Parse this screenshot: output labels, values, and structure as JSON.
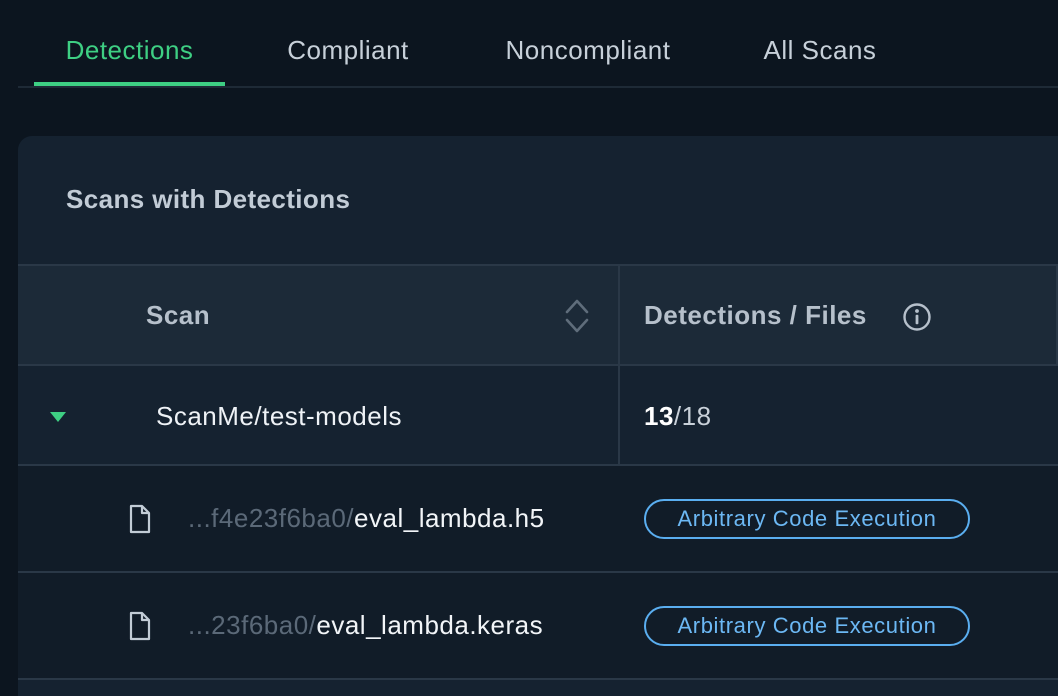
{
  "tabs": [
    {
      "label": "Detections",
      "active": true
    },
    {
      "label": "Compliant",
      "active": false
    },
    {
      "label": "Noncompliant",
      "active": false
    },
    {
      "label": "All Scans",
      "active": false
    }
  ],
  "card": {
    "title": "Scans with Detections"
  },
  "table": {
    "columns": [
      "Scan",
      "Detections / Files"
    ],
    "group": {
      "name": "ScanMe/test-models",
      "detections": "13",
      "separator": "/",
      "files": "18",
      "expanded": true
    },
    "rows": [
      {
        "prefix": "...f4e23f6ba0/",
        "filename": "eval_lambda.h5",
        "badge": "Arbitrary Code Execution"
      },
      {
        "prefix": "...23f6ba0/",
        "filename": "eval_lambda.keras",
        "badge": "Arbitrary Code Execution"
      }
    ]
  },
  "colors": {
    "accent": "#3ecf83",
    "badge": "#5aaef0",
    "background": "#0c151f",
    "card": "#152230"
  },
  "icons": {
    "sort": "sort-icon",
    "info": "info-icon",
    "caret": "caret-down-icon",
    "file": "file-icon"
  }
}
